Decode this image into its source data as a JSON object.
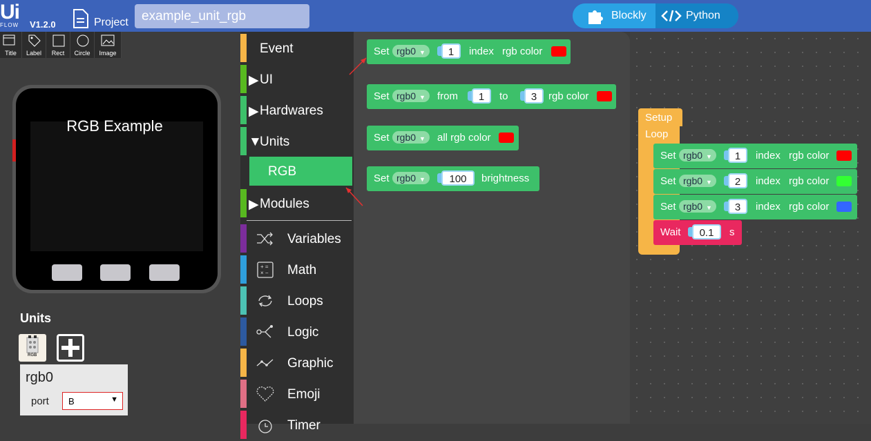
{
  "header": {
    "logo_main": "Ui",
    "logo_sub": "FLOW",
    "version": "V1.2.0",
    "project_label": "Project",
    "project_name": "example_unit_rgb",
    "mode_blockly": "Blockly",
    "mode_python": "Python"
  },
  "tools": [
    "Title",
    "Label",
    "Rect",
    "Circle",
    "Image"
  ],
  "device": {
    "screen_title": "RGB Example"
  },
  "units": {
    "title": "Units",
    "unit_icon_label": "RGB",
    "selected_name": "rgb0",
    "port_label": "port",
    "port_value": "B"
  },
  "categories": {
    "event": "Event",
    "ui": "UI",
    "hardwares": "Hardwares",
    "units": "Units",
    "rgb": "RGB",
    "modules": "Modules",
    "variables": "Variables",
    "math": "Math",
    "loops": "Loops",
    "logic": "Logic",
    "graphic": "Graphic",
    "emoji": "Emoji",
    "timer": "Timer"
  },
  "colors": {
    "event": "#f6b547",
    "ui": "#58b920",
    "hardwares": "#3dc06a",
    "units": "#3dc06a",
    "modules": "#58b920",
    "variables": "#7c2d9c",
    "math": "#2f9fdc",
    "loops": "#4cc2b4",
    "logic": "#2d5aa0",
    "graphic": "#f6b547",
    "emoji": "#e06f85",
    "timer": "#e9285f",
    "red": "#ff0000",
    "green": "#33ff33",
    "blue": "#3366ff"
  },
  "flyout": {
    "b1": {
      "set": "Set",
      "var": "rgb0",
      "n": "1",
      "index": "index",
      "rgbcolor": "rgb color"
    },
    "b2": {
      "set": "Set",
      "var": "rgb0",
      "from": "from",
      "n1": "1",
      "to": "to",
      "n2": "3",
      "rgbcolor": "rgb color"
    },
    "b3": {
      "set": "Set",
      "var": "rgb0",
      "all": "all rgb color"
    },
    "b4": {
      "set": "Set",
      "var": "rgb0",
      "n": "100",
      "brightness": "brightness"
    }
  },
  "workspace": {
    "setup": "Setup",
    "loop": "Loop",
    "rows": [
      {
        "set": "Set",
        "var": "rgb0",
        "n": "1",
        "index": "index",
        "rgbcolor": "rgb color"
      },
      {
        "set": "Set",
        "var": "rgb0",
        "n": "2",
        "index": "index",
        "rgbcolor": "rgb color"
      },
      {
        "set": "Set",
        "var": "rgb0",
        "n": "3",
        "index": "index",
        "rgbcolor": "rgb color"
      }
    ],
    "wait": {
      "label": "Wait",
      "n": "0.1",
      "unit": "s"
    }
  }
}
